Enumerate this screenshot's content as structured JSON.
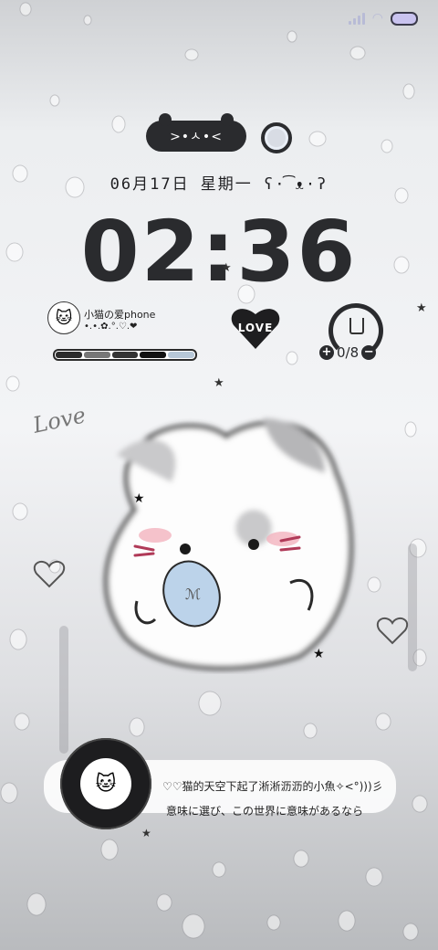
{
  "status_bar": {
    "signal_icon": "signal-icon",
    "wifi_icon": "wifi-icon",
    "battery_icon": "battery-icon",
    "battery_color": "#c9c3ef"
  },
  "top_widget": {
    "face": ">•ㅅ•<"
  },
  "date_line": "06月17日 星期一 ʕ·͡ᴥ·ʔ",
  "time": "02:36",
  "profile": {
    "name": "小猫の爱phone",
    "decor": "•.•.✿.°.♡.❤",
    "bar_colors": [
      "#2b2b2b",
      "#777777",
      "#333333",
      "#111111",
      "#b7c8d8"
    ]
  },
  "love_badge": "LOVE",
  "water": {
    "count": "0/8",
    "plus": "+",
    "minus": "−"
  },
  "love_script": "Love",
  "music": {
    "line1": "♡♡猫的天空下起了淅淅沥沥的小魚✧<°)))彡",
    "line2": "意味に選び、この世界に意味があるなら"
  }
}
